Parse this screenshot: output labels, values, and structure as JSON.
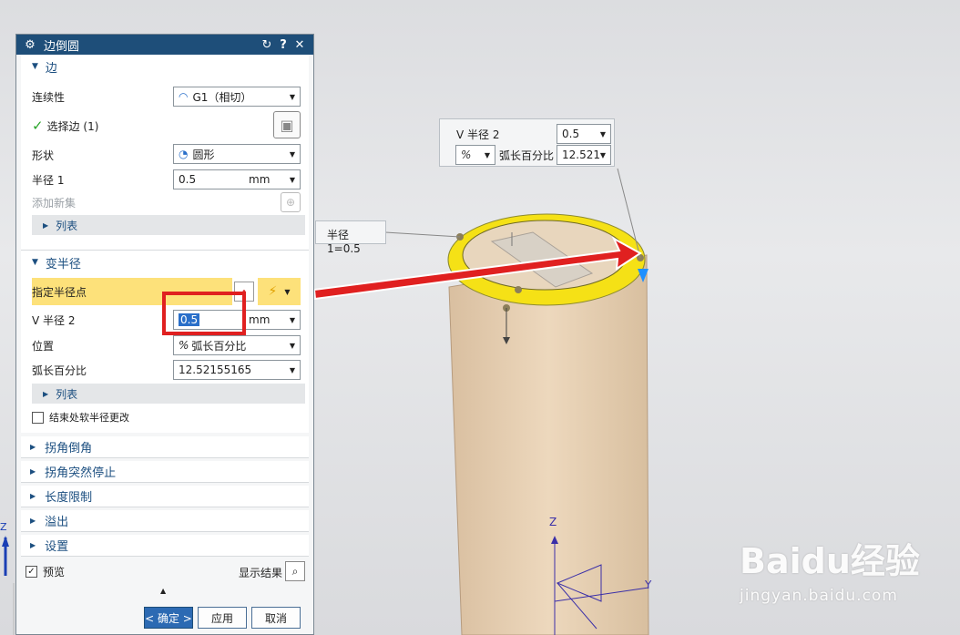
{
  "dialog": {
    "title": "边倒圆",
    "title_icons": {
      "gear": "⚙",
      "reset": "↻",
      "help": "?",
      "close": "✕"
    },
    "edge_section": {
      "header": "边",
      "continuity_label": "连续性",
      "continuity_value": "G1（相切）",
      "select_edge_label": "选择边 (1)",
      "shape_label": "形状",
      "shape_value": "圆形",
      "radius1_label": "半径 1",
      "radius1_value": "0.5",
      "radius1_unit": "mm",
      "add_new_set_label": "添加新集",
      "list_label": "列表"
    },
    "variable_radius": {
      "header": "变半径",
      "specify_point_label": "指定半径点",
      "v_radius2_label": "V 半径 2",
      "v_radius2_value": "0.5",
      "v_radius2_unit": "mm",
      "position_label": "位置",
      "position_value": "弧长百分比",
      "arc_percent_label": "弧长百分比",
      "arc_percent_value": "12.52155165",
      "list_label": "列表",
      "end_soft_label": "结束处软半径更改"
    },
    "collapsed_sections": [
      "拐角倒角",
      "拐角突然停止",
      "长度限制",
      "溢出",
      "设置"
    ],
    "preview_label": "预览",
    "show_result_label": "显示结果",
    "ok_label": "< 确定 >",
    "apply_label": "应用",
    "cancel_label": "取消"
  },
  "callout_top": {
    "v_radius2_label": "V 半径 2",
    "v_radius2_value": "0.5",
    "arc_label": "弧长百分比",
    "arc_value": "12.521",
    "percent_icon": "%"
  },
  "callout_radius1": {
    "text": "半径 1=0.5"
  },
  "axis_labels": {
    "z": "Z",
    "y": "Y"
  },
  "watermark": {
    "brand": "Baidu经验",
    "url": "jingyan.baidu.com"
  },
  "colors": {
    "titlebar": "#1e4e79",
    "highlight": "#fde17a",
    "annotation_red": "#e02020",
    "fillet_yellow": "#f5e116"
  }
}
